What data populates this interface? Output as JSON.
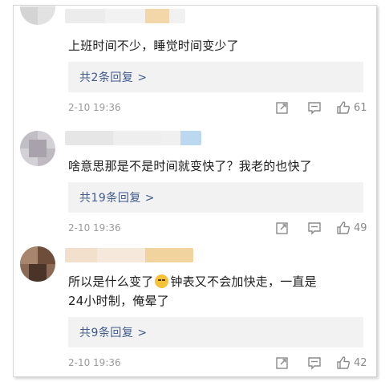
{
  "comments": [
    {
      "text": "上班时间不少，睡觉时间变少了",
      "reply_label": "共2条回复 >",
      "date": "2-10 19:36",
      "likes": "61"
    },
    {
      "text": "啥意思那是不是时间就变快了？我老的也快了",
      "reply_label": "共19条回复 >",
      "date": "2-10 19:36",
      "likes": "49"
    },
    {
      "text_a": "所以是什么变了",
      "text_b": "钟表又不会加快走，一直是",
      "text_c": "24小时制，俺晕了",
      "emoji": "dizzy-face-emoji",
      "reply_label": "共9条回复 >",
      "date": "2-10 19:36",
      "likes": "42"
    }
  ],
  "colors": {
    "reply_link": "#3f5a8f",
    "meta": "#9a9a9a",
    "reply_bg": "#f2f2f2"
  },
  "icons": [
    "share-icon",
    "comment-icon",
    "like-icon"
  ]
}
